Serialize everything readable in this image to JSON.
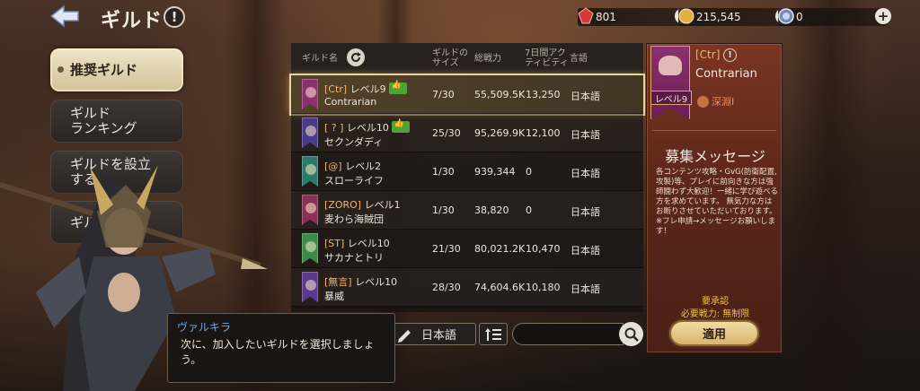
{
  "header": {
    "title": "ギルド",
    "info_glyph": "!"
  },
  "currencies": [
    {
      "icon": "ruby-icon",
      "color": "#d8383a",
      "value": "801"
    },
    {
      "icon": "gold-coin-icon",
      "color": "#e0b040",
      "value": "215,545"
    },
    {
      "icon": "crystal-icon",
      "color": "#9aa8c8",
      "value": "0"
    }
  ],
  "menu": {
    "items": [
      {
        "label": "推奨ギルド",
        "active": true
      },
      {
        "label": "ギルド\nランキング",
        "active": false
      },
      {
        "label": "ギルドを設立\nする",
        "active": false
      },
      {
        "label": "ギル",
        "active": false
      }
    ]
  },
  "table": {
    "headers": {
      "name": "ギルド名",
      "size": "ギルドの\nサイズ",
      "power": "総戦力",
      "activity": "7日間アク\nティビティ",
      "language": "言語"
    },
    "rows": [
      {
        "tag": "[Ctr]",
        "level": "レベル9",
        "name": "Contrarian",
        "size": "7/30",
        "power": "55,509.5K",
        "activity": "13,250",
        "language": "日本語",
        "banner_color": "#8c2f6e",
        "recommended": true,
        "selected": true
      },
      {
        "tag": "[ ? ]",
        "level": "レベル10",
        "name": "セクンダディ",
        "size": "25/30",
        "power": "95,269.9K",
        "activity": "12,100",
        "language": "日本語",
        "banner_color": "#4a3a8c",
        "recommended": true,
        "selected": false
      },
      {
        "tag": "[@]",
        "level": "レベル2",
        "name": "スローライフ",
        "size": "1/30",
        "power": "939,344",
        "activity": "0",
        "language": "日本語",
        "banner_color": "#2e7a6a",
        "recommended": false,
        "selected": false
      },
      {
        "tag": "[ZORO]",
        "level": "レベル1",
        "name": "麦わら海賊団",
        "size": "1/30",
        "power": "38,820",
        "activity": "0",
        "language": "日本語",
        "banner_color": "#8c2f58",
        "recommended": false,
        "selected": false
      },
      {
        "tag": "[ST]",
        "level": "レベル10",
        "name": "サカナとトリ",
        "size": "21/30",
        "power": "80,021.2K",
        "activity": "10,470",
        "language": "日本語",
        "banner_color": "#3a8c4a",
        "recommended": false,
        "selected": false
      },
      {
        "tag": "[無言]",
        "level": "レベル10",
        "name": "暴威",
        "size": "28/30",
        "power": "74,604.6K",
        "activity": "10,180",
        "language": "日本語",
        "banner_color": "#5a3a8c",
        "recommended": false,
        "selected": false
      }
    ]
  },
  "filters": {
    "language": "日本語",
    "search_placeholder": ""
  },
  "dialog": {
    "speaker": "ヴァルキラ",
    "message": "次に、加入したいギルドを選択しましょう。"
  },
  "detail": {
    "tag": "[Ctr]",
    "name": "Contrarian",
    "level_badge": "レベル9",
    "rank": "深淵Ⅰ",
    "heading": "募集メッセージ",
    "body": "各コンテンツ攻略・GvG(防衛配置,攻製)等、プレイに前向きな方は強師闘わず大歓迎！一緒に学び遊べる方を求めています。 無気力な方はお断りさせていただいております。 ※フレ申請→メッセージお願いします！",
    "requirement": "要承認",
    "power_req": "必要戦力: 無制限",
    "apply": "適用"
  }
}
